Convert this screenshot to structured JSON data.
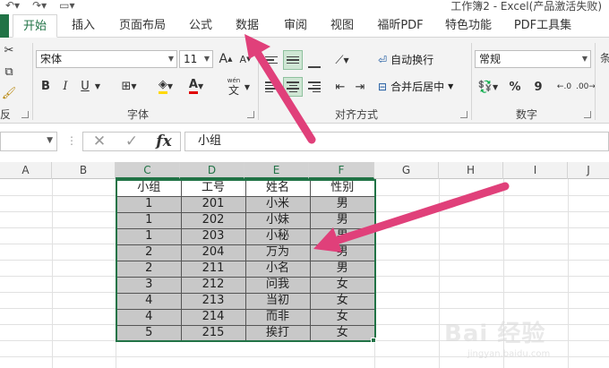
{
  "window": {
    "title": "工作簿2 - Excel(产品激活失败)"
  },
  "tabs": [
    {
      "label": "开始",
      "active": true
    },
    {
      "label": "插入"
    },
    {
      "label": "页面布局"
    },
    {
      "label": "公式"
    },
    {
      "label": "数据"
    },
    {
      "label": "审阅"
    },
    {
      "label": "视图"
    },
    {
      "label": "福昕PDF"
    },
    {
      "label": "特色功能"
    },
    {
      "label": "PDF工具集"
    }
  ],
  "ribbon": {
    "font": {
      "name": "宋体",
      "size": "11",
      "group_label": "字体"
    },
    "alignment": {
      "wrap_text": "自动换行",
      "merge_center": "合并后居中",
      "group_label": "对齐方式"
    },
    "number": {
      "format": "常规",
      "group_label": "数字",
      "percent": "%",
      "comma": "9"
    },
    "left_cut_label": "反",
    "right_cut_label": "条",
    "wen_label": "wén",
    "wen_char": "文"
  },
  "formula_bar": {
    "content": "小组",
    "fx": "fx"
  },
  "columns": [
    "A",
    "B",
    "C",
    "D",
    "E",
    "F",
    "G",
    "H",
    "I",
    "J"
  ],
  "table": {
    "headers": [
      "小组",
      "工号",
      "姓名",
      "性别"
    ],
    "rows": [
      [
        "1",
        "201",
        "小米",
        "男"
      ],
      [
        "1",
        "202",
        "小妹",
        "男"
      ],
      [
        "1",
        "203",
        "小秘",
        "男"
      ],
      [
        "2",
        "204",
        "万为",
        "男"
      ],
      [
        "2",
        "211",
        "小名",
        "男"
      ],
      [
        "3",
        "212",
        "问我",
        "女"
      ],
      [
        "4",
        "213",
        "当初",
        "女"
      ],
      [
        "4",
        "214",
        "而非",
        "女"
      ],
      [
        "5",
        "215",
        "挨打",
        "女"
      ]
    ]
  },
  "watermark": {
    "logo": "Bai 经验",
    "url": "jingyan.baidu.com"
  },
  "colors": {
    "accent": "#217346",
    "arrow": "#e0407a",
    "selection_fill": "#c8c8c8"
  }
}
